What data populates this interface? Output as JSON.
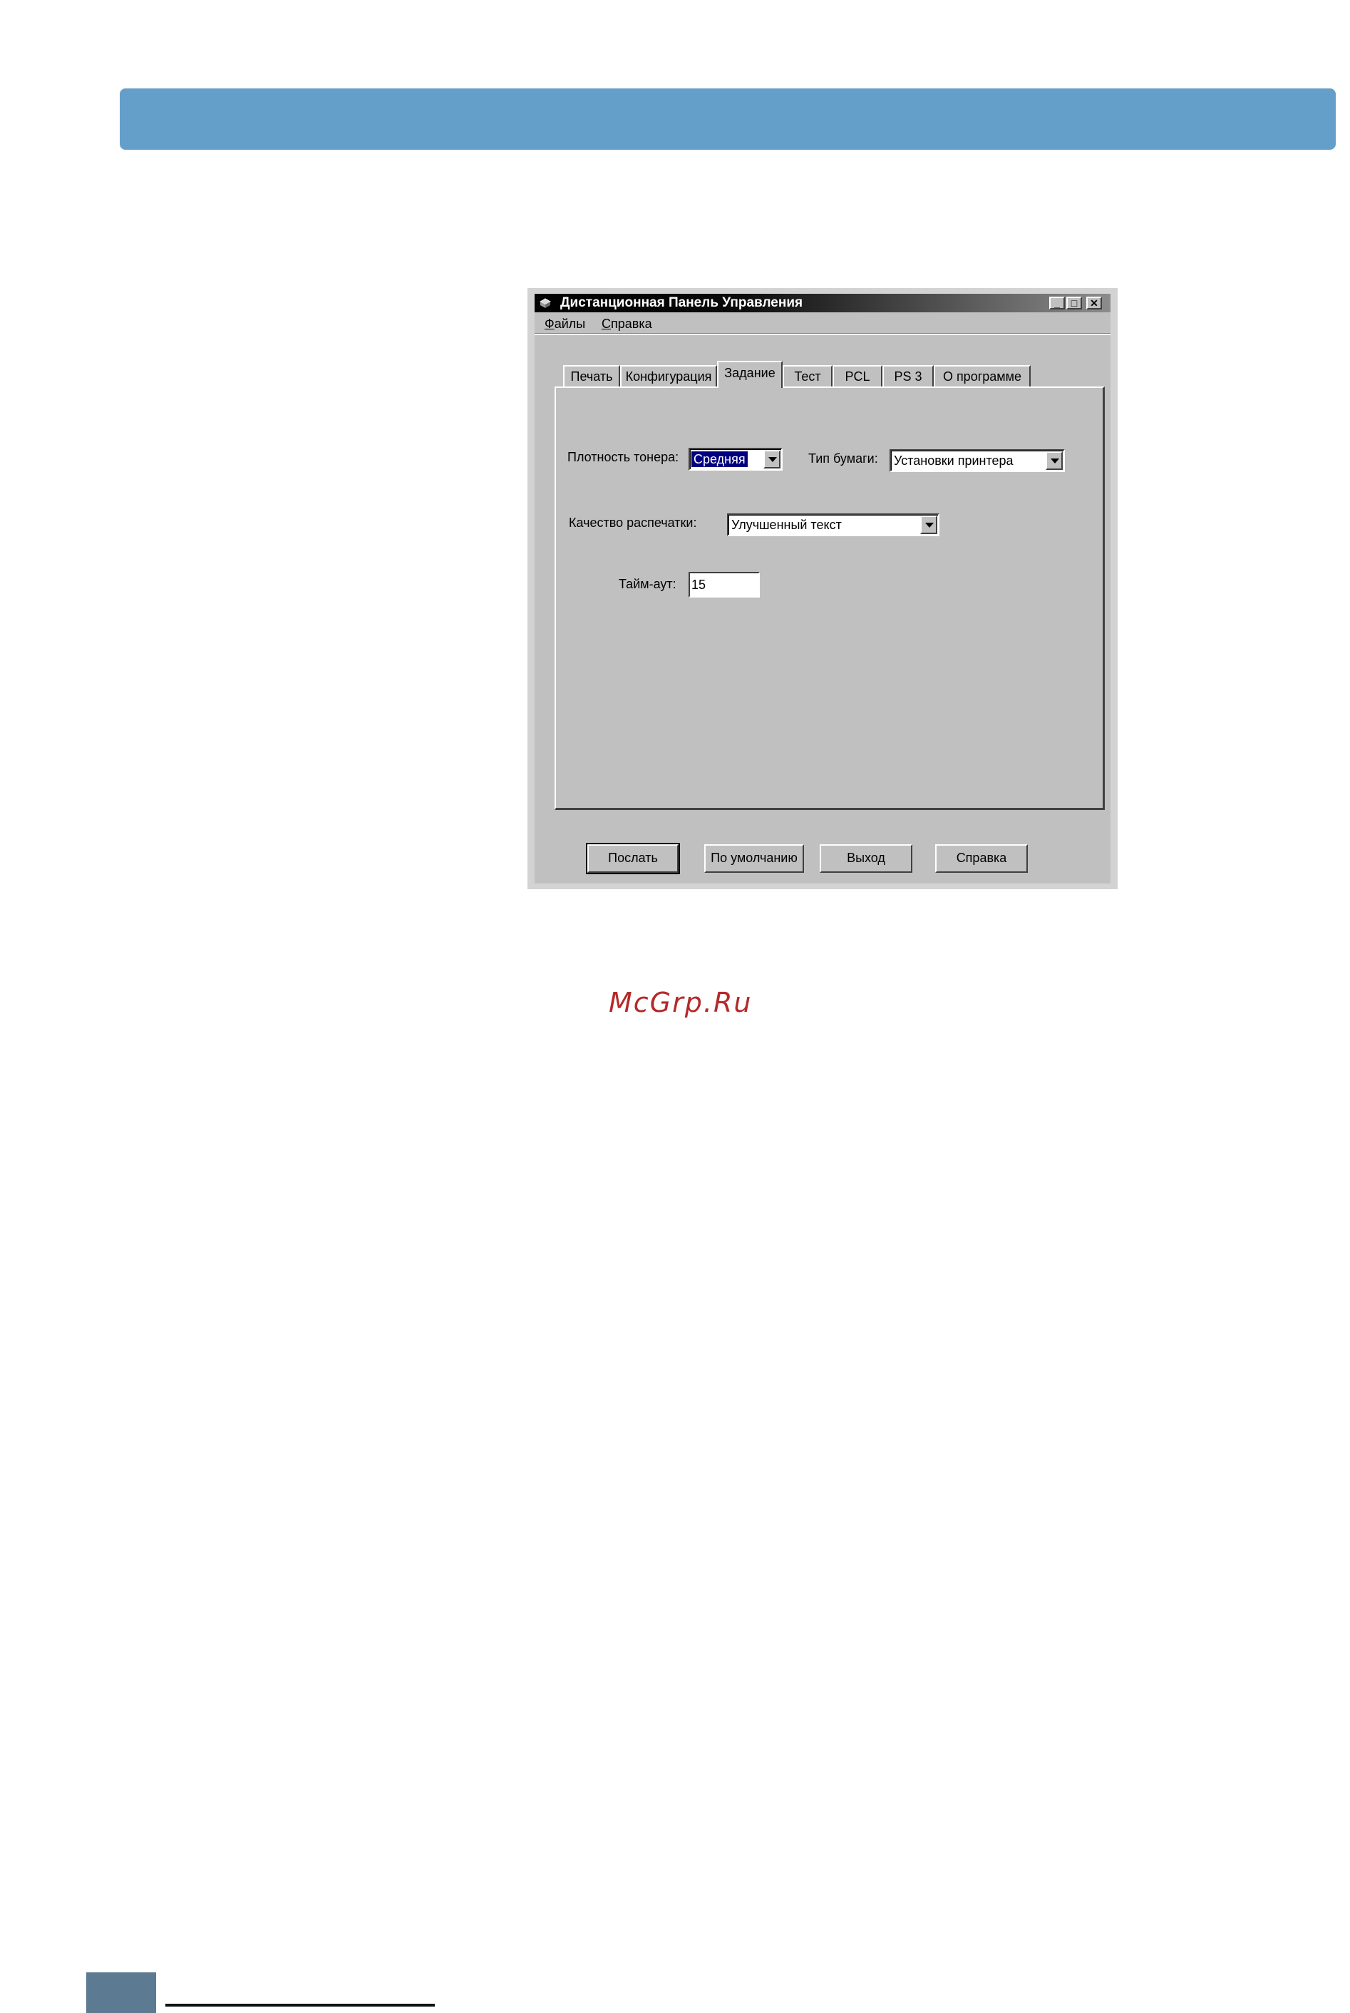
{
  "window": {
    "title": "Дистанционная Панель Управления",
    "minimize": "_",
    "maximize": "□",
    "close": "✕",
    "icon": "printer-icon"
  },
  "menu": {
    "files_hotkey": "Ф",
    "files_rest": "айлы",
    "help_hotkey": "С",
    "help_rest": "правка"
  },
  "tabs": [
    "Печать",
    "Конфигурация",
    "Задание",
    "Тест",
    "PCL",
    "PS 3",
    "О программе"
  ],
  "active_tab": "Задание",
  "form": {
    "toner_label": "Плотность тонера:",
    "toner_value": "Средняя",
    "paper_label": "Тип бумаги:",
    "paper_value": "Установки принтера",
    "quality_label": "Качество распечатки:",
    "quality_value": "Улучшенный текст",
    "timeout_label": "Тайм-аут:",
    "timeout_value": "15"
  },
  "buttons": {
    "send": "Послать",
    "default": "По умолчанию",
    "exit": "Выход",
    "help": "Справка"
  },
  "watermark": "McGrp.Ru",
  "colors": {
    "header_bar": "#649fc9",
    "watermark": "#b52a2a",
    "footer_block": "#5c7a92"
  }
}
